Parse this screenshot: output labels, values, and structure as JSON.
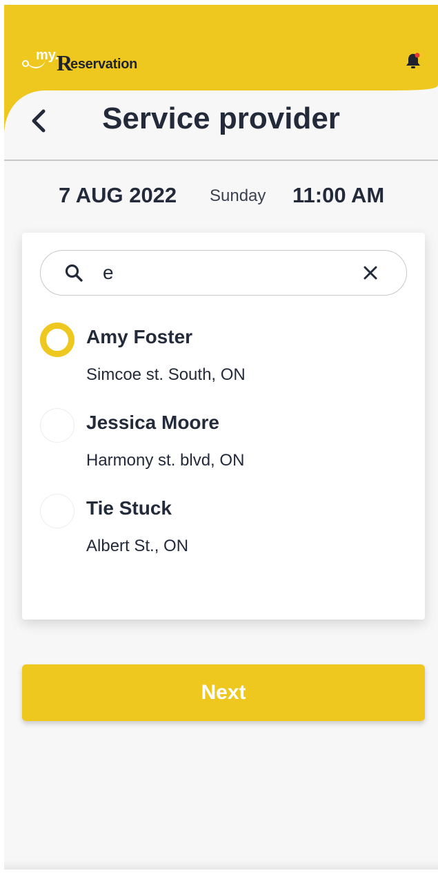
{
  "app": {
    "logo_my": "my.",
    "logo_r": "R",
    "logo_rest": "eservation",
    "accent_color": "#efc81f",
    "text_color": "#232a3a"
  },
  "header": {
    "title": "Service provider",
    "back_icon": "chevron-left-icon",
    "notification_icon": "bell-icon"
  },
  "booking": {
    "date": "7 AUG 2022",
    "day": "Sunday",
    "time": "11:00 AM"
  },
  "search": {
    "value": "e",
    "search_icon": "search-icon",
    "clear_icon": "close-icon"
  },
  "providers": [
    {
      "name": "Amy Foster",
      "address": "Simcoe st. South, ON",
      "selected": true
    },
    {
      "name": "Jessica Moore",
      "address": "Harmony st. blvd, ON",
      "selected": false
    },
    {
      "name": "Tie Stuck",
      "address": "Albert St., ON",
      "selected": false
    }
  ],
  "actions": {
    "next_label": "Next"
  }
}
